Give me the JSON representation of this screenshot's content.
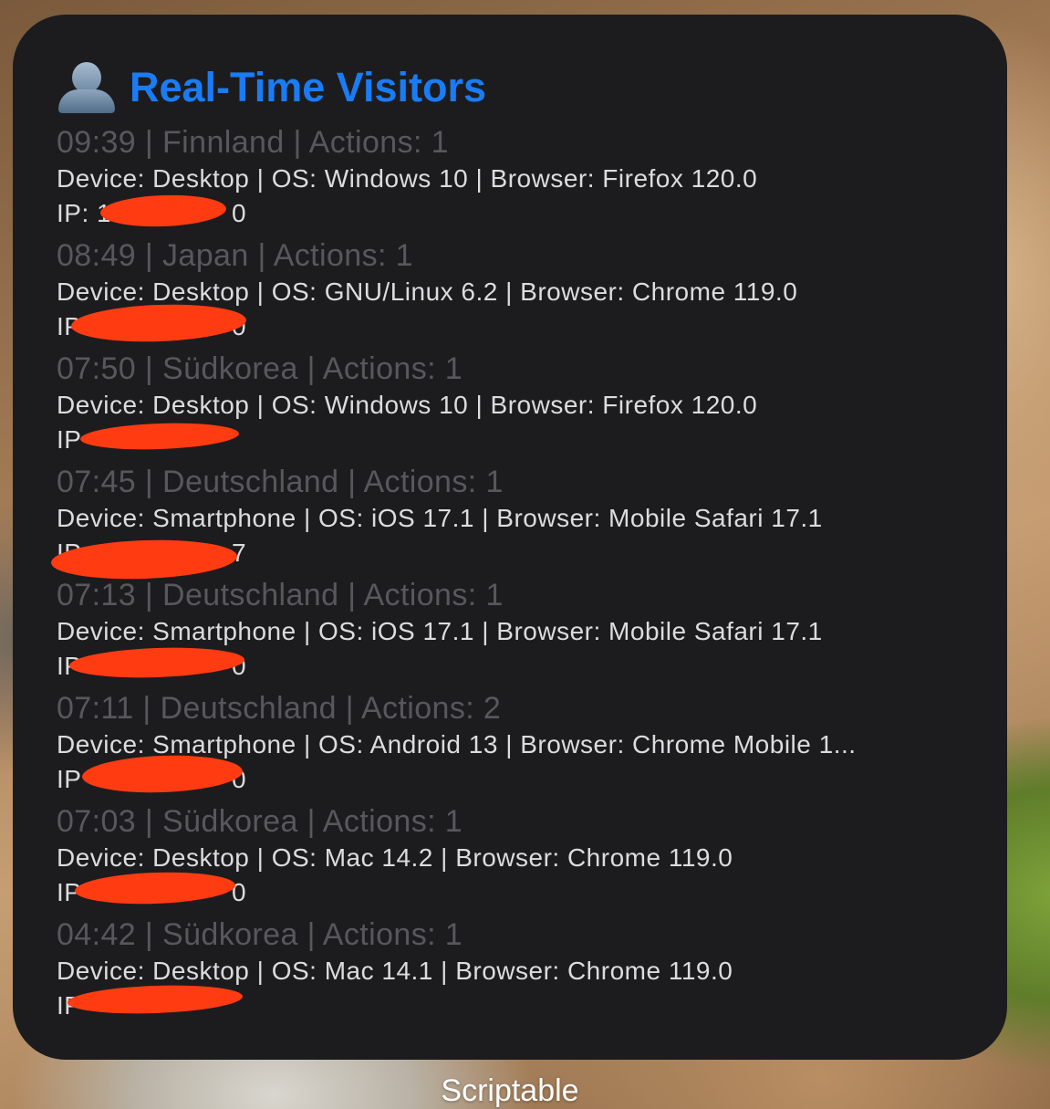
{
  "widget": {
    "title": "Real-Time Visitors",
    "icon": "person-silhouette-icon",
    "title_color": "#1a7cf5",
    "background_color": "#1c1c1e",
    "visitors": [
      {
        "summary": "09:39 | Finnland | Actions: 1",
        "details": "Device: Desktop | OS: Windows 10 | Browser: Firefox 120.0",
        "ip_label": "IP: 1",
        "ip_tail": "0"
      },
      {
        "summary": "08:49 | Japan | Actions: 1",
        "details": "Device: Desktop | OS: GNU/Linux 6.2 | Browser: Chrome 119.0",
        "ip_label": "IP",
        "ip_tail": "0"
      },
      {
        "summary": "07:50 | Südkorea | Actions: 1",
        "details": "Device: Desktop | OS: Windows 10 | Browser: Firefox 120.0",
        "ip_label": "IP",
        "ip_tail": ""
      },
      {
        "summary": "07:45 | Deutschland | Actions: 1",
        "details": "Device: Smartphone | OS: iOS 17.1 | Browser: Mobile Safari 17.1",
        "ip_label": "IP",
        "ip_tail": "7"
      },
      {
        "summary": "07:13 | Deutschland | Actions: 1",
        "details": "Device: Smartphone | OS: iOS 17.1 | Browser: Mobile Safari 17.1",
        "ip_label": "IP",
        "ip_tail": "0"
      },
      {
        "summary": "07:11 | Deutschland | Actions: 2",
        "details": "Device: Smartphone | OS: Android 13 | Browser: Chrome Mobile 1...",
        "ip_label": "IP",
        "ip_tail": "0"
      },
      {
        "summary": "07:03 | Südkorea | Actions: 1",
        "details": "Device: Desktop | OS: Mac 14.2 | Browser: Chrome 119.0",
        "ip_label": "IP",
        "ip_tail": "0"
      },
      {
        "summary": "04:42 | Südkorea | Actions: 1",
        "details": "Device: Desktop | OS: Mac 14.1 | Browser: Chrome 119.0",
        "ip_label": "IP",
        "ip_tail": ""
      }
    ]
  },
  "app_label": "Scriptable",
  "redaction_color": "#ff3b12"
}
